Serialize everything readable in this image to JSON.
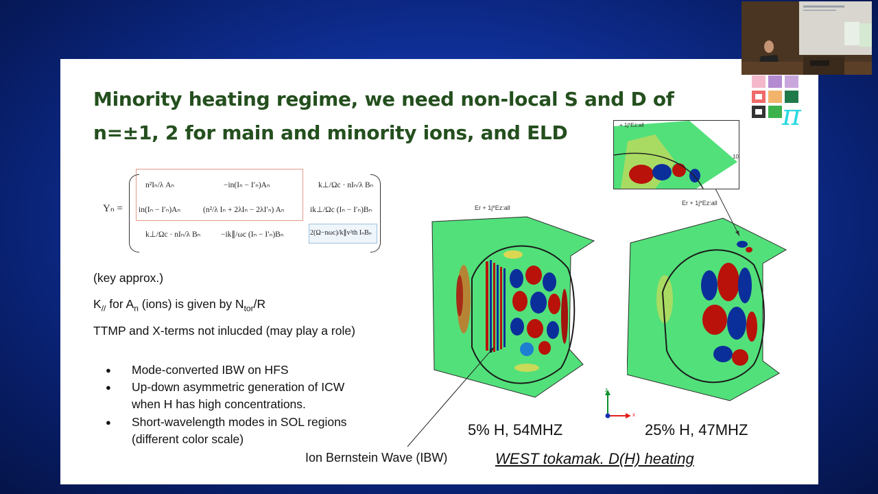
{
  "slide": {
    "title_line1": "Minority heating regime, we need non-local S and D of",
    "title_line2": "n=±1, 2 for main and minority ions, and ELD",
    "equation": {
      "lhs": "Yₙ =",
      "r1c1": "n²Iₙ/λ Aₙ",
      "r1c2": "−in(Iₙ − I′ₙ)Aₙ",
      "r1c3": "k⊥/Ωc · nIₙ/λ Bₙ",
      "r2c1": "in(Iₙ − I′ₙ)Aₙ",
      "r2c2": "(n²/λ Iₙ + 2λIₙ − 2λI′ₙ) Aₙ",
      "r2c3": "ik⊥/Ωc (Iₙ − I′ₙ)Bₙ",
      "r3c1": "k⊥/Ωc · nIₙ/λ Bₙ",
      "r3c2": "−ik∥/ωc (Iₙ − I′ₙ)Bₙ",
      "r3c3": "2(Ω−nωc)/k∥v²th IₙBₙ"
    },
    "key_approx": "(key approx.)",
    "k_line_prefix": "K",
    "k_line_sub1": "//",
    "k_line_mid": " for A",
    "k_line_sub2": "n",
    "k_line_mid2": " (ions) is given by N",
    "k_line_sub3": "tor",
    "k_line_end": "/R",
    "ttmp_line": "TTMP and X-terms not inlucded (may play a role)",
    "bullets": [
      {
        "line1": "Mode-converted IBW on HFS",
        "line2": ""
      },
      {
        "line1": "Up-down asymmetric generation of ICW",
        "line2": "when H has high concentrations."
      },
      {
        "line1": "Short-wavelength modes in SOL regions",
        "line2": "(different color scale)"
      }
    ],
    "plot_label_left": "Er + 1j*Ez:all",
    "plot_label_right": "Er + 1j*Ez:all",
    "inset_label": "+ 1j*Ez:all",
    "inset_tick": "10",
    "caption_left": "5% H, 54MHZ",
    "caption_right": "25% H, 47MHZ",
    "ibw_label": "Ion Bernstein Wave (IBW)",
    "west_label": "WEST tokamak. D(H) heating",
    "axis_z": "z",
    "axis_x": "x"
  },
  "colors": {
    "title_green": "#244f1e",
    "field_green": "#52e07a",
    "red": "#b8120a",
    "blue": "#0b2f9a",
    "background_blue": "#0f2f96"
  },
  "icons": {
    "logo": "pi-logo-icon",
    "axis": "axis-triad-icon"
  }
}
